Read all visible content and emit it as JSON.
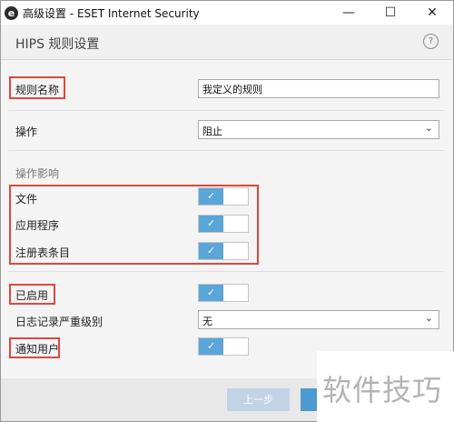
{
  "window": {
    "title": "高级设置 - ESET Internet Security",
    "app_icon_letter": "e",
    "controls": {
      "minimize": "—",
      "maximize": "☐",
      "close": "✕"
    }
  },
  "header": {
    "title": "HIPS 规则设置",
    "help": "?"
  },
  "form": {
    "rule_name": {
      "label": "规则名称",
      "value": "我定义的规则"
    },
    "action": {
      "label": "操作",
      "value": "阻止"
    },
    "affects": {
      "heading": "操作影响",
      "files": {
        "label": "文件",
        "enabled": true
      },
      "apps": {
        "label": "应用程序",
        "enabled": true
      },
      "registry": {
        "label": "注册表条目",
        "enabled": true
      }
    },
    "enabled": {
      "label": "已启用",
      "enabled": true
    },
    "log_severity": {
      "label": "日志记录严重级别",
      "value": "无"
    },
    "notify_user": {
      "label": "通知用户",
      "enabled": true
    }
  },
  "toggle_glyph": "✓",
  "footer": {
    "prev_label": "上一步"
  },
  "watermark": "软件技巧",
  "colors": {
    "toggle_on": "#5aa6d8",
    "highlight": "#e0463f",
    "button_disabled": "#c2d3e6",
    "button_primary": "#4c9ad0"
  }
}
